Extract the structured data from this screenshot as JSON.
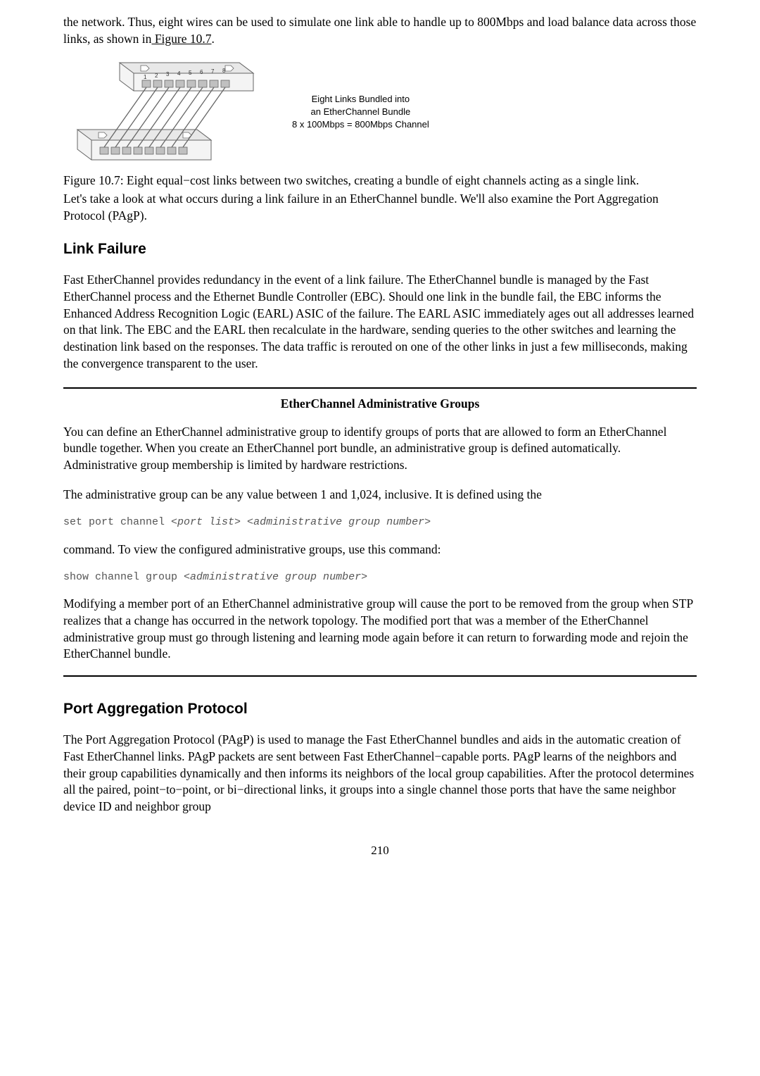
{
  "intro": {
    "line1": "the network. Thus, eight wires can be used to simulate one link able to handle up to 800Mbps and load balance data across those links, as shown in",
    "link": " Figure 10.7",
    "end": "."
  },
  "diagram": {
    "bundle_line1": "Eight Links Bundled into",
    "bundle_line2": "an EtherChannel Bundle",
    "bundle_line3": "8 x 100Mbps = 800Mbps Channel",
    "port_labels": [
      "1",
      "2",
      "3",
      "4",
      "5",
      "6",
      "7",
      "8"
    ]
  },
  "caption": "Figure 10.7: Eight equal−cost links between two switches, creating a bundle of eight channels acting as a single link.",
  "intro2": "Let's take a look at what occurs during a link failure in an EtherChannel bundle. We'll also examine the Port Aggregation Protocol (PAgP).",
  "linkFailure": {
    "heading": "Link Failure",
    "body": "Fast EtherChannel provides redundancy in the event of a link failure. The EtherChannel bundle is managed by the Fast EtherChannel process and the Ethernet Bundle Controller (EBC). Should one link in the bundle fail, the EBC informs the Enhanced Address Recognition Logic (EARL) ASIC of the failure. The EARL ASIC immediately ages out all addresses learned on that link. The EBC and the EARL then recalculate in the hardware, sending queries to the other switches and learning the destination link based on the responses. The data traffic is rerouted on one of the other links in just a few milliseconds, making the convergence transparent to the user."
  },
  "box": {
    "title": "EtherChannel Administrative Groups",
    "p1": "You can define an EtherChannel administrative group to identify groups of ports that are allowed to form an EtherChannel bundle together. When you create an EtherChannel port bundle, an administrative group is defined automatically. Administrative group membership is limited by hardware restrictions.",
    "p2": "The administrative group can be any value between 1 and 1,024, inclusive. It is defined using the",
    "code1_pre": "set port channel <",
    "code1_arg1": "port list",
    "code1_mid": "> <",
    "code1_arg2": "administrative group number",
    "code1_post": ">",
    "p3": "command. To view the configured administrative groups, use this command:",
    "code2_pre": "show channel group <",
    "code2_arg": "administrative group number",
    "code2_post": ">",
    "p4": "Modifying a member port of an EtherChannel administrative group will cause the port to be removed from the group when STP realizes that a change has occurred in the network topology. The modified port that was a member of the EtherChannel administrative group must go through listening and learning mode again before it can return to forwarding mode and rejoin the EtherChannel bundle."
  },
  "pagp": {
    "heading": "Port Aggregation Protocol",
    "body": "The Port Aggregation Protocol (PAgP) is used to manage the Fast EtherChannel bundles and aids in the automatic creation of Fast EtherChannel links. PAgP packets are sent between Fast EtherChannel−capable ports. PAgP learns of the neighbors and their group capabilities dynamically and then informs its neighbors of the local group capabilities. After the protocol determines all the paired, point−to−point, or bi−directional links, it groups into a single channel those ports that have the same neighbor device ID and neighbor group"
  },
  "pageNumber": "210"
}
